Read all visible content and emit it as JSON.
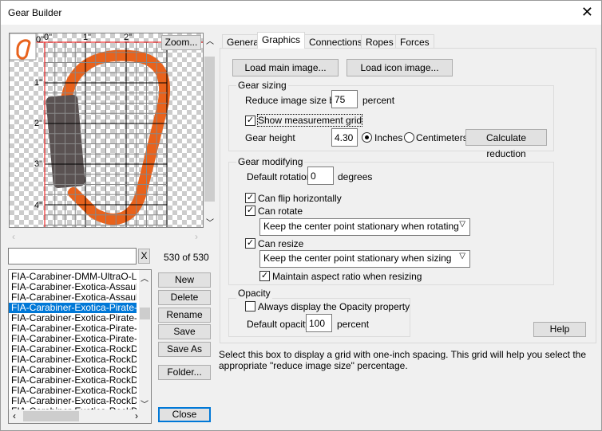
{
  "window": {
    "title": "Gear Builder",
    "close_icon": "close-icon"
  },
  "preview": {
    "zoom_label": "Zoom...",
    "ruler_x": [
      "0\"",
      "1\"",
      "2\""
    ],
    "ruler_y": [
      "0\"",
      "1\"",
      "2\"",
      "3\"",
      "4\""
    ]
  },
  "search": {
    "value": "",
    "clear_label": "X",
    "count": "530 of 530"
  },
  "list": {
    "items": [
      "FIA-Carabiner-DMM-UltraO-Locks",
      "FIA-Carabiner-Exotica-Assault-Sta",
      "FIA-Carabiner-Exotica-Assault-Sta",
      "FIA-Carabiner-Exotica-Pirate-Oran",
      "FIA-Carabiner-Exotica-Pirate-Oran",
      "FIA-Carabiner-Exotica-Pirate-Oran",
      "FIA-Carabiner-Exotica-Pirate-Wire",
      "FIA-Carabiner-Exotica-RockD-Lar",
      "FIA-Carabiner-Exotica-RockD-Re",
      "FIA-Carabiner-Exotica-RockD-Re",
      "FIA-Carabiner-Exotica-RockD-Re",
      "FIA-Carabiner-Exotica-RockD-Re",
      "FIA-Carabiner-Exotica-RockD-Re",
      "FIA-Carabiner-Exotica-RockD-St"
    ],
    "selected_index": 3
  },
  "buttons": {
    "new": "New",
    "delete": "Delete",
    "rename": "Rename",
    "save": "Save",
    "save_as": "Save As",
    "folder": "Folder...",
    "close": "Close"
  },
  "tabs": [
    "General",
    "Graphics",
    "Connections",
    "Ropes",
    "Forces"
  ],
  "active_tab": "Graphics",
  "graphics": {
    "load_main": "Load main image...",
    "load_icon": "Load icon image...",
    "sizing": {
      "title": "Gear sizing",
      "reduce_label": "Reduce image size by",
      "reduce_value": "75",
      "reduce_unit": "percent",
      "show_grid_label": "Show measurement grid",
      "show_grid": true,
      "height_label": "Gear height",
      "height_value": "4.30",
      "inches": "Inches",
      "centimeters": "Centimeters",
      "unit_selected": "Inches",
      "calc": "Calculate reduction"
    },
    "modifying": {
      "title": "Gear modifying",
      "rotation_label": "Default rotation",
      "rotation_value": "0",
      "rotation_unit": "degrees",
      "flip_label": "Can flip horizontally",
      "flip": true,
      "rotate_label": "Can rotate",
      "rotate": true,
      "rotate_option": "Keep the center point stationary when rotating",
      "resize_label": "Can resize",
      "resize": true,
      "resize_option": "Keep the center point stationary when sizing",
      "aspect_label": "Maintain aspect ratio when resizing",
      "aspect": true
    },
    "opacity": {
      "title": "Opacity",
      "always_label": "Always display the Opacity property",
      "always": false,
      "default_label": "Default opacity",
      "default_value": "100",
      "default_unit": "percent"
    },
    "help": "Help"
  },
  "hint": "Select this box to display a grid with one-inch spacing. This grid will help you select the appropriate \"reduce image size\" percentage.",
  "colors": {
    "accent": "#0078d7",
    "gear": "#e8621c"
  }
}
